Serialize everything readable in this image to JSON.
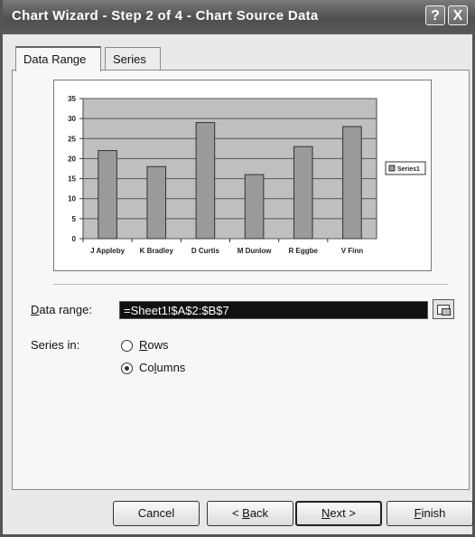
{
  "window": {
    "title": "Chart Wizard - Step 2 of 4 - Chart Source Data",
    "help_label": "?",
    "close_label": "X"
  },
  "tabs": [
    {
      "label": "Data Range",
      "active": true
    },
    {
      "label": "Series",
      "active": false
    }
  ],
  "form": {
    "data_range_label_pre": "D",
    "data_range_label_post": "ata range:",
    "data_range_value": "=Sheet1!$A$2:$B$7",
    "series_in_label": "Series in:",
    "option_rows_pre": "R",
    "option_rows_post": "ows",
    "option_columns_pre": "Co",
    "option_columns_mid": "l",
    "option_columns_post": "umns",
    "selected": "Columns"
  },
  "buttons": {
    "cancel": "Cancel",
    "back_pre": "< ",
    "back_u": "B",
    "back_post": "ack",
    "next_u": "N",
    "next_post": "ext >",
    "finish_u": "F",
    "finish_post": "inish"
  },
  "chart_data": {
    "type": "bar",
    "categories": [
      "J Appleby",
      "K Bradley",
      "D Curtis",
      "M Dunlow",
      "R Eggbe",
      "V Finn"
    ],
    "series": [
      {
        "name": "Series1",
        "values": [
          22,
          18,
          29,
          16,
          23,
          28
        ]
      }
    ],
    "ylim": [
      0,
      35
    ],
    "yticks": [
      0,
      5,
      10,
      15,
      20,
      25,
      30,
      35
    ],
    "grid": true,
    "legend": "right",
    "colors": {
      "plot_bg": "#bfbfbf",
      "bar": "#9a9a9a",
      "grid": "#555555"
    }
  }
}
